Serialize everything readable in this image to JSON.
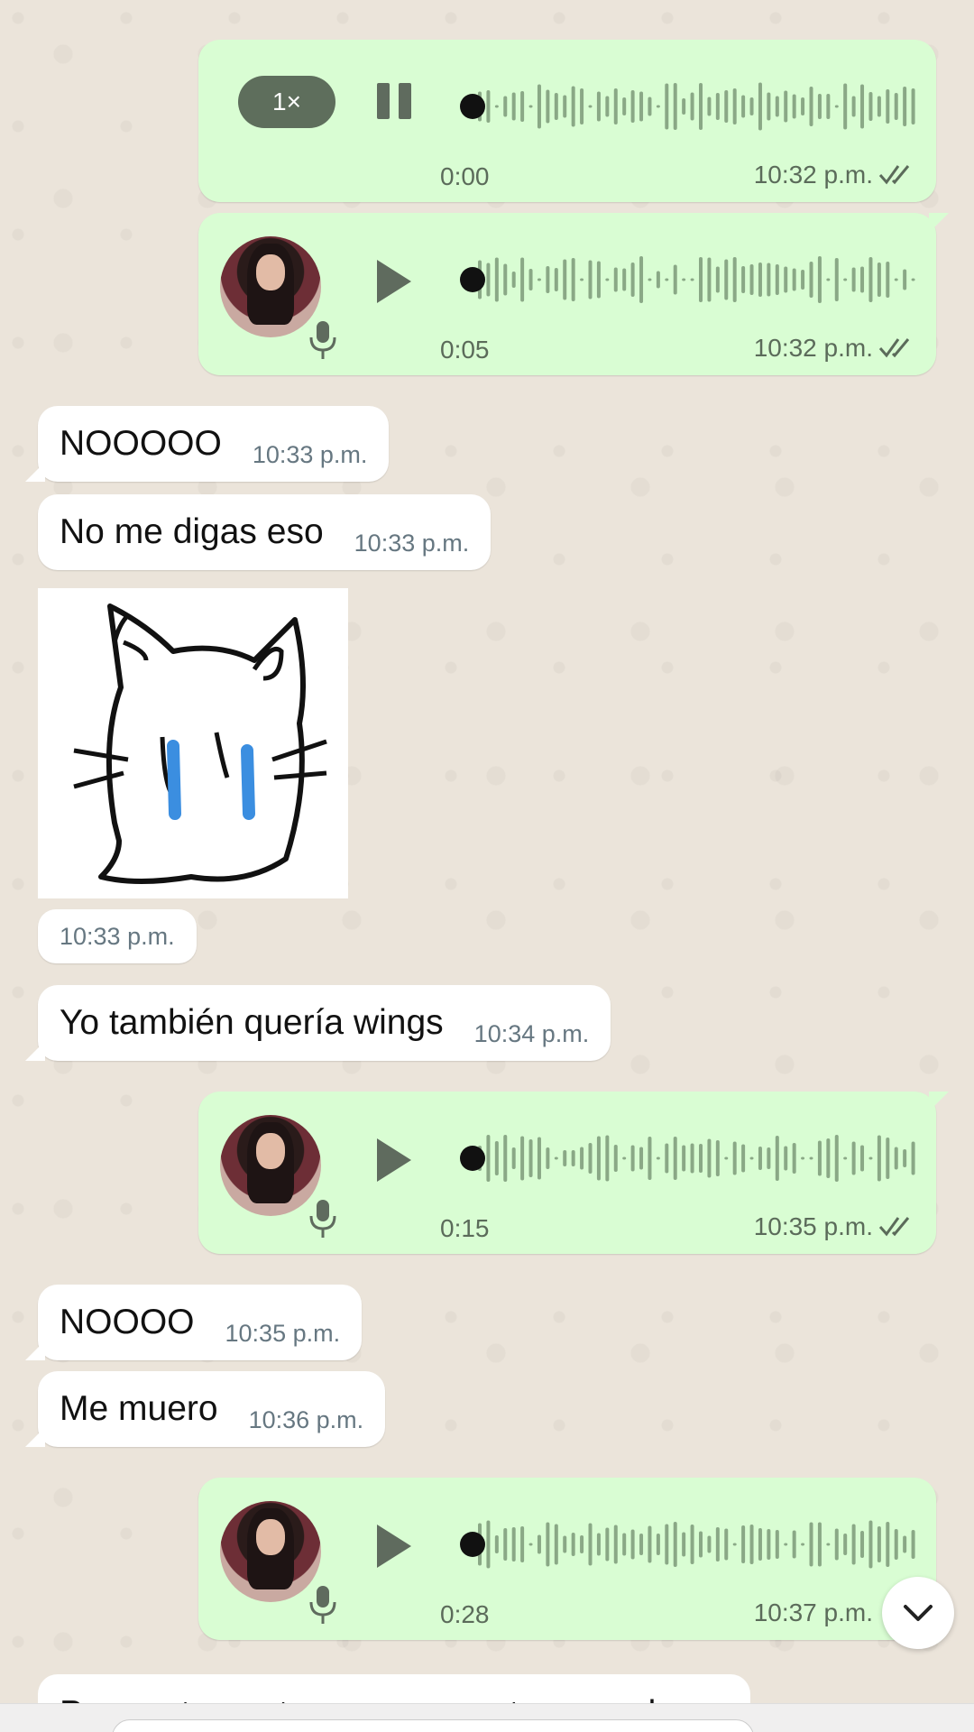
{
  "messages": {
    "voice1": {
      "speed": "1×",
      "duration": "0:00",
      "time": "10:32 p.m."
    },
    "voice2": {
      "duration": "0:05",
      "time": "10:32 p.m."
    },
    "text1": {
      "text": "NOOOOO",
      "time": "10:33 p.m."
    },
    "text2": {
      "text": "No me digas eso",
      "time": "10:33 p.m."
    },
    "sticker": {
      "time": "10:33 p.m."
    },
    "text3": {
      "text": "Yo también quería wings",
      "time": "10:34 p.m."
    },
    "voice3": {
      "duration": "0:15",
      "time": "10:35 p.m."
    },
    "text4": {
      "text": "NOOOO",
      "time": "10:35 p.m."
    },
    "text5": {
      "text": "Me muero",
      "time": "10:36 p.m."
    },
    "voice4": {
      "duration": "0:28",
      "time": "10:37 p.m."
    },
    "text6_partial": {
      "text": "Para esto punto no nos va a tocar nada"
    }
  },
  "colors": {
    "outgoing_bubble": "#d9fdd3",
    "incoming_bubble": "#ffffff",
    "meta_text": "#667781",
    "wave_played": "#111111",
    "wave_unplayed": "#8aa886"
  },
  "icons": {
    "play": "play-icon",
    "pause": "pause-icon",
    "mic": "mic-icon",
    "read": "double-check-icon",
    "scroll": "chevron-down-icon"
  }
}
